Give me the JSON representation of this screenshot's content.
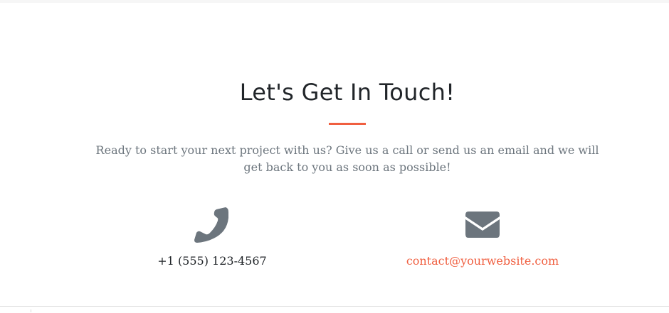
{
  "section": {
    "heading": "Let's Get In Touch!",
    "lead": "Ready to start your next project with us? Give us a call or send us an email and we will get back to you as soon as possible!"
  },
  "phone": {
    "icon": "phone-icon",
    "number": "+1 (555) 123-4567"
  },
  "email": {
    "icon": "envelope-icon",
    "address": "contact@yourwebsite.com"
  },
  "colors": {
    "accent": "#f05f40",
    "icon": "#6c757d",
    "heading": "#212529",
    "muted": "#6c757d"
  }
}
